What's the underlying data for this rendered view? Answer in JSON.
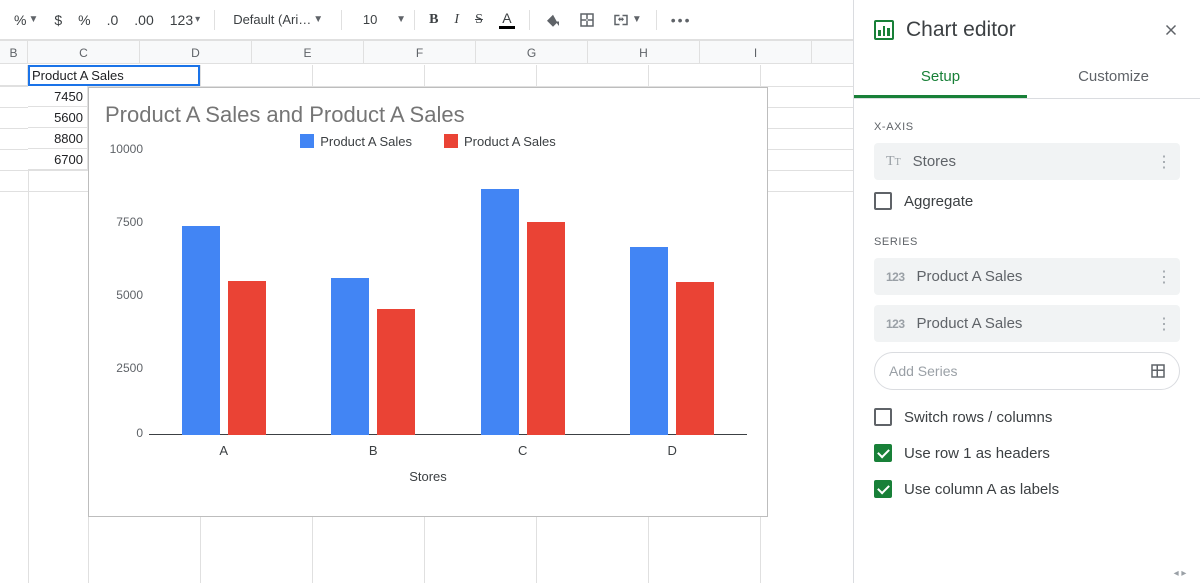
{
  "toolbar": {
    "percent": "%",
    "currency": "$",
    "dec_dec": ".0",
    "dec_inc": ".00",
    "num123": "123",
    "font": "Default (Ari…",
    "size": "10",
    "bold": "B",
    "italic": "I",
    "strike": "S",
    "textcolor": "A",
    "more": "•••"
  },
  "columns": [
    "B",
    "C",
    "D",
    "E",
    "F",
    "G",
    "H",
    "I"
  ],
  "cells": {
    "b_header": "duct A Sales",
    "c_header": "Product A Sales",
    "b2": "7450",
    "b3": "5600",
    "b4": "8800",
    "b5": "6700"
  },
  "chart_data": {
    "type": "bar",
    "title": "Product A Sales and Product A Sales",
    "categories": [
      "A",
      "B",
      "C",
      "D"
    ],
    "series": [
      {
        "name": "Product A Sales",
        "values": [
          7450,
          5600,
          8800,
          6700
        ],
        "color": "#4285f4"
      },
      {
        "name": "Product A Sales",
        "values": [
          5500,
          4500,
          7600,
          5450
        ],
        "color": "#ea4335"
      }
    ],
    "xlabel": "Stores",
    "ylabel": "",
    "ylim": [
      0,
      10000
    ],
    "yticks": [
      0,
      2500,
      5000,
      7500,
      10000
    ]
  },
  "sidebar": {
    "title": "Chart editor",
    "tabs": {
      "setup": "Setup",
      "customize": "Customize"
    },
    "xaxis_label": "X-AXIS",
    "xaxis_value": "Stores",
    "aggregate": "Aggregate",
    "series_label": "SERIES",
    "series": [
      "Product A Sales",
      "Product A Sales"
    ],
    "add_series": "Add Series",
    "switch": "Switch rows / columns",
    "row1": "Use row 1 as headers",
    "colA": "Use column A as labels"
  }
}
